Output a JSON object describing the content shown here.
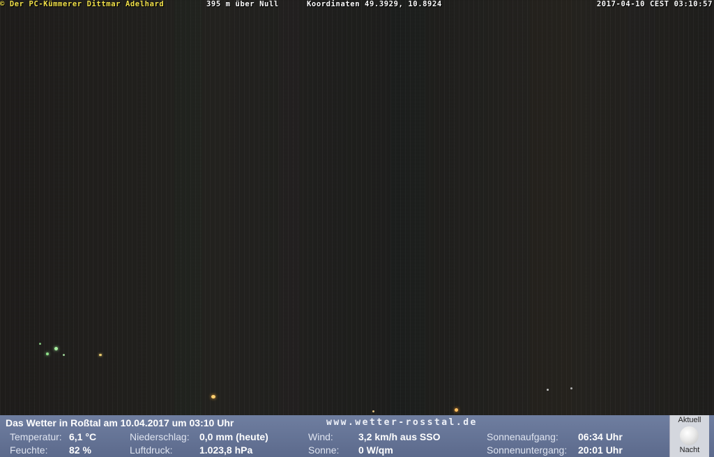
{
  "overlay": {
    "copyright": "© Der PC-Kümmerer Dittmar Adelhard",
    "altitude": "395 m über Null",
    "coordinates": "Koordinaten 49.3929, 10.8924",
    "timestamp": "2017-04-10 CEST 03:10:57"
  },
  "weather": {
    "title": "Das Wetter in Roßtal am 10.04.2017 um 03:10 Uhr",
    "website": "www.wetter-rosstal.de",
    "temperature": {
      "label": "Temperatur:",
      "value": "6,1 °C"
    },
    "humidity": {
      "label": "Feuchte:",
      "value": "82 %"
    },
    "precipitation": {
      "label": "Niederschlag:",
      "value": "0,0 mm (heute)"
    },
    "pressure": {
      "label": "Luftdruck:",
      "value": "1.023,8 hPa"
    },
    "wind": {
      "label": "Wind:",
      "value": "3,2 km/h aus SSO"
    },
    "sun": {
      "label": "Sonne:",
      "value": "0 W/qm"
    },
    "sunrise": {
      "label": "Sonnenaufgang:",
      "value": "06:34 Uhr"
    },
    "sunset": {
      "label": "Sonnenuntergang:",
      "value": "20:01 Uhr"
    }
  },
  "moon": {
    "top_label": "Aktuell",
    "bottom_label": "Nacht",
    "icon": "moon-icon"
  }
}
